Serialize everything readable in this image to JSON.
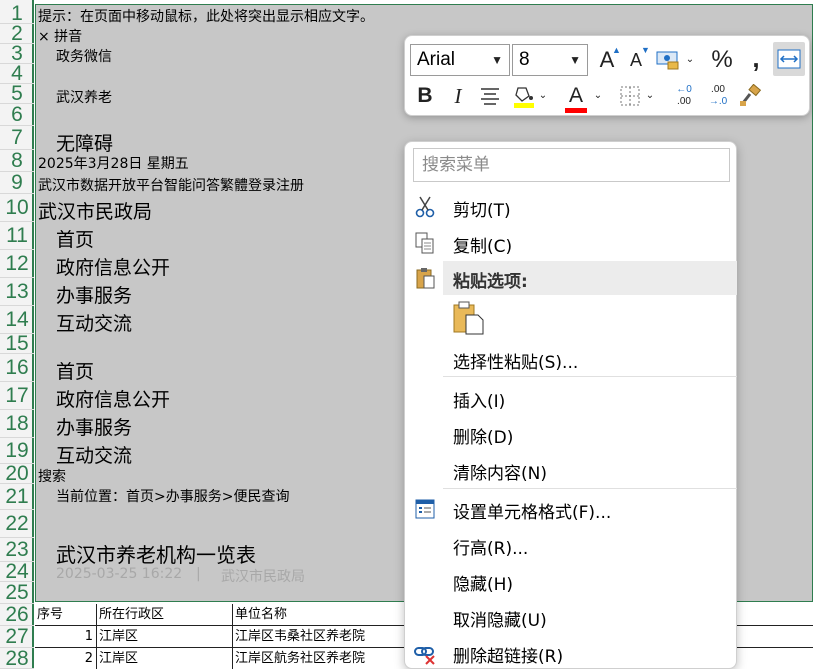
{
  "row_numbers": [
    "1",
    "2",
    "3",
    "4",
    "5",
    "6",
    "7",
    "8",
    "9",
    "10",
    "11",
    "12",
    "13",
    "14",
    "15",
    "16",
    "17",
    "18",
    "19",
    "20",
    "21",
    "22",
    "23",
    "24",
    "25",
    "26",
    "27",
    "28"
  ],
  "cells": {
    "r1": "提示：在页面中移动鼠标，此处将突出显示相应文字。",
    "r2": "× 拼音",
    "r3": "政务微信",
    "r5": "武汉养老",
    "r7": "无障碍",
    "r8": "2025年3月28日 星期五",
    "r9": "武汉市数据开放平台智能问答繁體登录注册",
    "r10": "武汉市民政局",
    "r11": "首页",
    "r12": "政府信息公开",
    "r13": "办事服务",
    "r14": "互动交流",
    "r16": "首页",
    "r17": "政府信息公开",
    "r18": "办事服务",
    "r19": "互动交流",
    "r20": "搜索",
    "r21": "当前位置：首页>办事服务>便民查询",
    "r23": "武汉市养老机构一览表",
    "r24_date": "2025-03-25 16:22",
    "r24_sep": "|",
    "r24_src": "武汉市民政局"
  },
  "table": {
    "headers": [
      "序号",
      "所在行政区",
      "单位名称"
    ],
    "rows": [
      {
        "no": "1",
        "district": "江岸区",
        "name": "江岸区韦桑社区养老院"
      },
      {
        "no": "2",
        "district": "江岸区",
        "name": "江岸区航务社区养老院"
      }
    ]
  },
  "mini_toolbar": {
    "font_name": "Arial",
    "font_size": "8",
    "grow_font": "A",
    "shrink_font": "A",
    "percent": "%",
    "comma": ",",
    "bold": "B",
    "italic": "I",
    "font_color_letter": "A",
    "inc_decimal_top": "←0",
    "inc_decimal_bottom": ".00",
    "dec_decimal_top": ".00",
    "dec_decimal_bottom": "→.0",
    "highlight_color": "#ffff00",
    "font_color": "#ff0000"
  },
  "context_menu": {
    "search_placeholder": "搜索菜单",
    "cut": "剪切(T)",
    "copy": "复制(C)",
    "paste_options": "粘贴选项:",
    "paste_special": "选择性粘贴(S)...",
    "insert": "插入(I)",
    "delete": "删除(D)",
    "clear": "清除内容(N)",
    "format_cells": "设置单元格格式(F)...",
    "row_height": "行高(R)...",
    "hide": "隐藏(H)",
    "unhide": "取消隐藏(U)",
    "remove_hyperlink": "删除超链接(R)"
  },
  "colors": {
    "accent_green": "#2f7d4f",
    "selection_grey": "#c7c7c7"
  }
}
